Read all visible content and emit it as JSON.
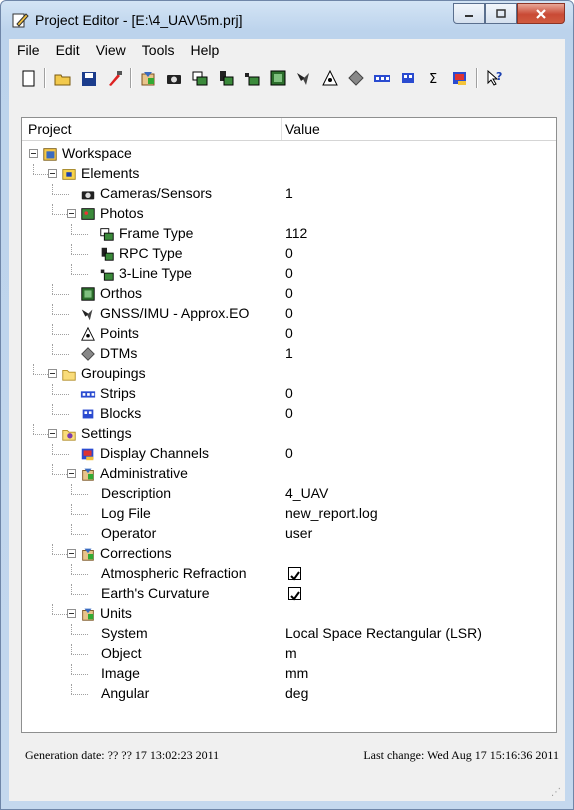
{
  "window": {
    "title": "Project Editor - [E:\\4_UAV\\5m.prj]"
  },
  "menu": [
    "File",
    "Edit",
    "View",
    "Tools",
    "Help"
  ],
  "toolbar": [
    "new-file-icon",
    "open-folder-icon",
    "save-icon",
    "brush-icon",
    "sep",
    "settings-icon",
    "camera-icon",
    "frame-photo-icon",
    "rpc-photo-icon",
    "three-line-photo-icon",
    "ortho-icon",
    "gnss-icon",
    "points-icon",
    "dtm-icon",
    "strips-icon",
    "blocks-icon",
    "sigma-icon",
    "display-channels-icon",
    "sep",
    "help-pointer-icon"
  ],
  "columns": {
    "project": "Project",
    "value": "Value"
  },
  "tree": [
    {
      "id": "workspace",
      "depth": 0,
      "exp": true,
      "icon": "workspace-icon",
      "label": "Workspace",
      "value": ""
    },
    {
      "id": "elements",
      "depth": 1,
      "exp": true,
      "icon": "elements-icon",
      "label": "Elements",
      "value": ""
    },
    {
      "id": "cameras",
      "depth": 2,
      "exp": false,
      "icon": "camera-icon",
      "label": "Cameras/Sensors",
      "value": "1"
    },
    {
      "id": "photos",
      "depth": 2,
      "exp": true,
      "icon": "photos-icon",
      "label": "Photos",
      "value": ""
    },
    {
      "id": "frame-type",
      "depth": 3,
      "exp": false,
      "icon": "frame-photo-icon",
      "label": "Frame Type",
      "value": "112"
    },
    {
      "id": "rpc-type",
      "depth": 3,
      "exp": false,
      "icon": "rpc-photo-icon",
      "label": "RPC Type",
      "value": "0"
    },
    {
      "id": "three-line-type",
      "depth": 3,
      "exp": false,
      "icon": "three-line-photo-icon",
      "label": "3-Line Type",
      "value": "0"
    },
    {
      "id": "orthos",
      "depth": 2,
      "exp": false,
      "icon": "ortho-icon",
      "label": "Orthos",
      "value": "0"
    },
    {
      "id": "gnss",
      "depth": 2,
      "exp": false,
      "icon": "gnss-icon",
      "label": "GNSS/IMU - Approx.EO",
      "value": "0"
    },
    {
      "id": "points",
      "depth": 2,
      "exp": false,
      "icon": "points-icon",
      "label": "Points",
      "value": "0"
    },
    {
      "id": "dtms",
      "depth": 2,
      "exp": false,
      "icon": "dtm-icon",
      "label": "DTMs",
      "value": "1"
    },
    {
      "id": "groupings",
      "depth": 1,
      "exp": true,
      "icon": "folder-icon",
      "label": "Groupings",
      "value": ""
    },
    {
      "id": "strips",
      "depth": 2,
      "exp": false,
      "icon": "strips-icon",
      "label": "Strips",
      "value": "0"
    },
    {
      "id": "blocks",
      "depth": 2,
      "exp": false,
      "icon": "blocks-icon",
      "label": "Blocks",
      "value": "0"
    },
    {
      "id": "settings",
      "depth": 1,
      "exp": true,
      "icon": "settings-folder-icon",
      "label": "Settings",
      "value": ""
    },
    {
      "id": "display-channels",
      "depth": 2,
      "exp": false,
      "icon": "display-channels-icon",
      "label": "Display Channels",
      "value": "0"
    },
    {
      "id": "administrative",
      "depth": 2,
      "exp": true,
      "icon": "settings-icon",
      "label": "Administrative",
      "value": ""
    },
    {
      "id": "description",
      "depth": 3,
      "exp": false,
      "icon": "",
      "label": "Description",
      "value": "4_UAV"
    },
    {
      "id": "log-file",
      "depth": 3,
      "exp": false,
      "icon": "",
      "label": "Log File",
      "value": "new_report.log"
    },
    {
      "id": "operator",
      "depth": 3,
      "exp": false,
      "icon": "",
      "label": "Operator",
      "value": "user"
    },
    {
      "id": "corrections",
      "depth": 2,
      "exp": true,
      "icon": "settings-icon",
      "label": "Corrections",
      "value": ""
    },
    {
      "id": "atmospheric-refraction",
      "depth": 3,
      "exp": false,
      "icon": "",
      "label": "Atmospheric Refraction",
      "value": "",
      "checkbox": true
    },
    {
      "id": "earths-curvature",
      "depth": 3,
      "exp": false,
      "icon": "",
      "label": "Earth's Curvature",
      "value": "",
      "checkbox": true
    },
    {
      "id": "units",
      "depth": 2,
      "exp": true,
      "icon": "settings-icon",
      "label": "Units",
      "value": ""
    },
    {
      "id": "system",
      "depth": 3,
      "exp": false,
      "icon": "",
      "label": "System",
      "value": "Local Space Rectangular (LSR)"
    },
    {
      "id": "object",
      "depth": 3,
      "exp": false,
      "icon": "",
      "label": "Object",
      "value": "m"
    },
    {
      "id": "image",
      "depth": 3,
      "exp": false,
      "icon": "",
      "label": "Image",
      "value": "mm"
    },
    {
      "id": "angular",
      "depth": 3,
      "exp": false,
      "icon": "",
      "label": "Angular",
      "value": "deg"
    }
  ],
  "status": {
    "generation": "Generation date:  ?? ?? 17 13:02:23 2011",
    "last_change": "Last change:  Wed Aug 17 15:16:36 2011"
  }
}
